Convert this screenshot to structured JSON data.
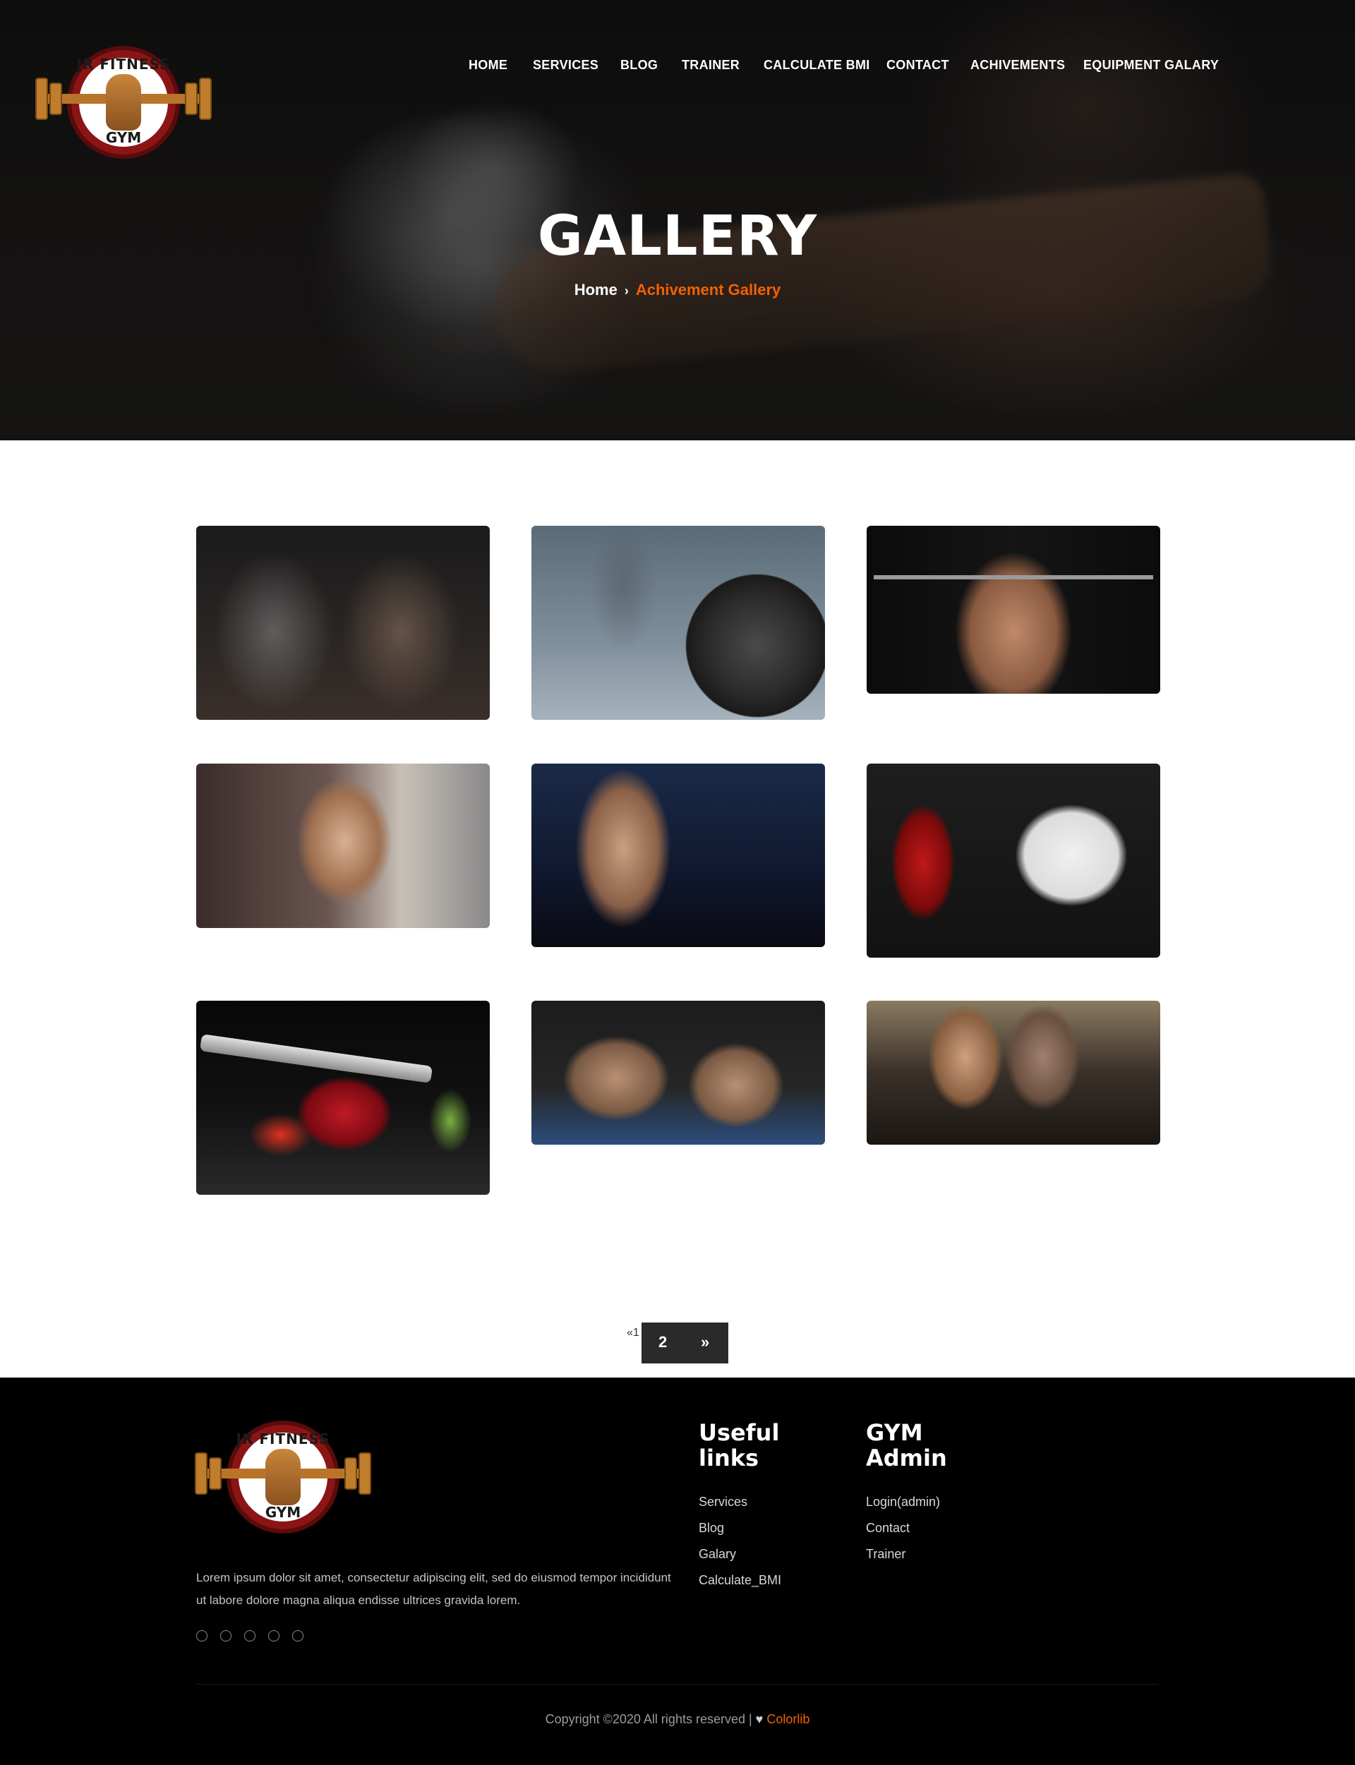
{
  "nav": {
    "items": [
      "HOME",
      "SERVICES",
      "BLOG",
      "TRAINER",
      "CALCULATE BMI",
      "CONTACT",
      "ACHIVEMENTS",
      "EQUIPMENT GALARY"
    ]
  },
  "logo": {
    "top_text": "JR FITNESS",
    "bottom_text": "GYM"
  },
  "hero": {
    "title": "GALLERY",
    "breadcrumb": {
      "home": "Home",
      "separator": "›",
      "current": "Achivement Gallery"
    }
  },
  "gallery": {
    "images": [
      "battle-ropes-photo",
      "rogue-barbell-plate-photo",
      "shirtless-barbell-photo",
      "woman-gym-bench-photo",
      "woman-dumbbells-city-photo",
      "tomatoes-avocado-eggs-photo",
      "dumbbell-steak-vegetables-photo",
      "couple-handshake-floor-photo",
      "spin-bike-class-photo"
    ]
  },
  "pagination": {
    "prev": "«",
    "page1": "1",
    "page2": "2",
    "next": "»"
  },
  "footer": {
    "description": "Lorem ipsum dolor sit amet, consectetur adipiscing elit, sed do eiusmod tempor incididunt ut labore dolore magna aliqua endisse ultrices gravida lorem.",
    "useful_links": {
      "title": "Useful links",
      "links": [
        "Services",
        "Blog",
        "Galary",
        "Calculate_BMI"
      ]
    },
    "admin": {
      "title": "GYM Admin",
      "links": [
        "Login(admin)",
        "Contact",
        "Trainer"
      ]
    },
    "copyright": {
      "text": "Copyright ©2020 All rights reserved | ",
      "heart": "♥",
      "brand": "Colorlib"
    }
  },
  "colors": {
    "accent": "#f36100",
    "footer_bg": "#000000",
    "pagination_bg": "#2a2a2a"
  }
}
